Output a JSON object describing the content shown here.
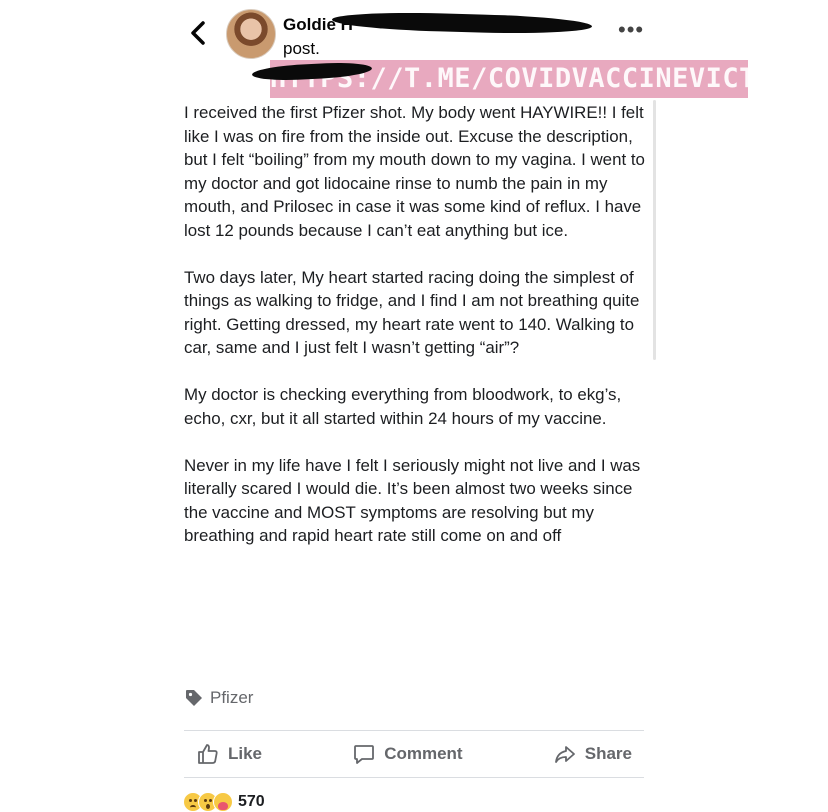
{
  "header": {
    "author_name": "Goldie H",
    "post_suffix": "post.",
    "more_label": "•••"
  },
  "watermark": "HTTPS://T.ME/COVIDVACCINEVICTIMS",
  "post": {
    "paragraphs": [
      "I received the first Pfizer shot.  My body went HAYWIRE!! I felt like I was on fire from the inside out. Excuse the description, but I felt “boiling”  from my mouth down to my vagina. I went to my doctor and got lidocaine rinse to numb the pain in my mouth,  and Prilosec in case it was some kind of reflux. I have lost 12 pounds because I can’t eat anything but ice.",
      "Two days later, My heart started racing  doing the simplest of things as walking to fridge,  and I find I am not breathing quite right. Getting dressed, my heart rate went to 140. Walking to car, same and I just felt I wasn’t getting “air”?",
      "My doctor is checking everything from bloodwork, to ekg’s, echo, cxr, but it all started within 24 hours of my vaccine.",
      "Never in my life have I felt I seriously might not live and I was literally scared I would die.  It’s been almost two weeks since the vaccine and MOST symptoms are resolving but my breathing and rapid heart rate still come on and off"
    ]
  },
  "tag": {
    "label": "Pfizer"
  },
  "actions": {
    "like": "Like",
    "comment": "Comment",
    "share": "Share"
  },
  "reactions": {
    "count": "570"
  },
  "colors": {
    "text": "#1c1e21",
    "muted": "#65676b",
    "watermark_bg": "#e49ab4",
    "divider": "#dadde1"
  }
}
